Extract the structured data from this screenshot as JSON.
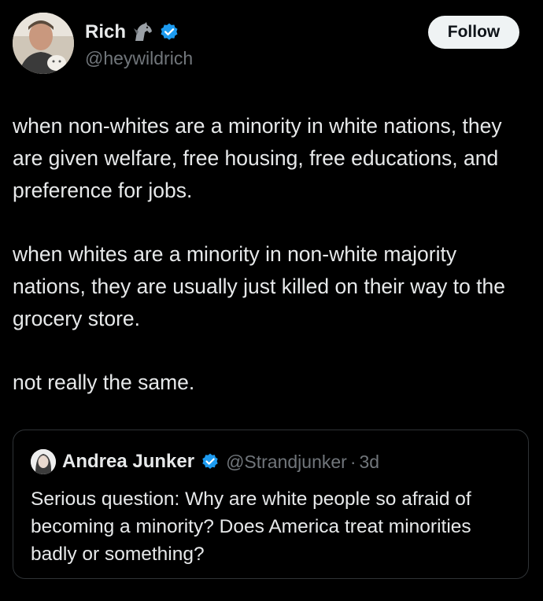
{
  "author": {
    "display_name": "Rich",
    "handle": "@heywildrich",
    "emoji_icon": "horse-icon",
    "verified_icon": "verified-badge-icon"
  },
  "follow_button": {
    "label": "Follow"
  },
  "tweet": {
    "paragraphs": [
      "when non-whites are a minority in white nations, they are given welfare, free housing, free educations, and preference for jobs.",
      "when whites are a minority in non-white majority nations, they are usually just killed on their way to the grocery store.",
      "not really the same."
    ]
  },
  "quoted_tweet": {
    "author_name": "Andrea Junker",
    "handle": "@Strandjunker",
    "separator": "·",
    "time": "3d",
    "text": "Serious question: Why are white people so afraid of becoming a minority? Does America treat minorities badly or something?"
  },
  "colors": {
    "background": "#000000",
    "primary_text": "#e7e9ea",
    "secondary_text": "#71767b",
    "verified_blue": "#1d9bf0",
    "card_border": "#2f3336",
    "follow_bg": "#eff3f4"
  }
}
